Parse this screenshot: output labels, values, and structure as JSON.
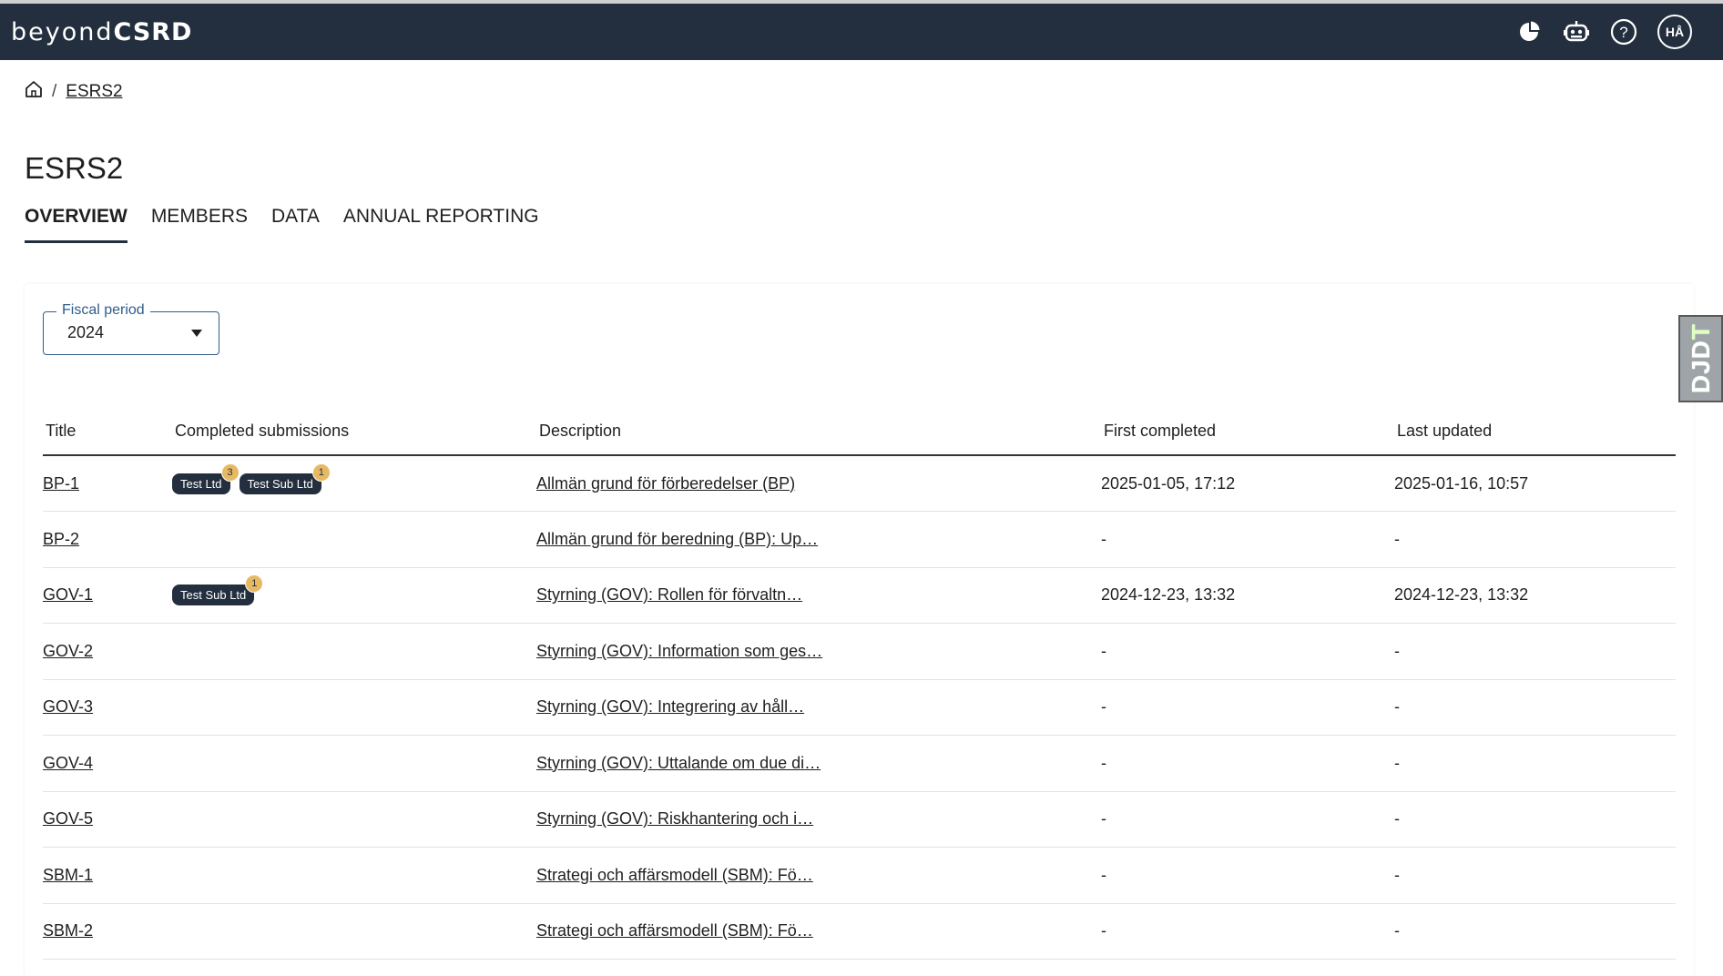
{
  "app": {
    "logo_thin": "beyond",
    "logo_bold": "CSRD",
    "avatar_initials": "HÅ"
  },
  "icons": {
    "chart": "pie-chart-icon",
    "bot": "robot-icon",
    "help": "help-circle-icon",
    "home": "home-icon"
  },
  "breadcrumb": {
    "separator": "/",
    "current": "ESRS2"
  },
  "page": {
    "title": "ESRS2"
  },
  "tabs": [
    {
      "label": "OVERVIEW",
      "active": true
    },
    {
      "label": "MEMBERS",
      "active": false
    },
    {
      "label": "DATA",
      "active": false
    },
    {
      "label": "ANNUAL REPORTING",
      "active": false
    }
  ],
  "fiscal_period": {
    "label": "Fiscal period",
    "value": "2024"
  },
  "table": {
    "headers": [
      "Title",
      "Completed submissions",
      "Description",
      "First completed",
      "Last updated"
    ],
    "rows": [
      {
        "title": "BP-1",
        "submissions": [
          {
            "name": "Test Ltd",
            "count": "3"
          },
          {
            "name": "Test Sub Ltd",
            "count": "1"
          }
        ],
        "description": "Allmän grund för förberedelser (BP)",
        "first_completed": "2025-01-05, 17:12",
        "last_updated": "2025-01-16, 10:57"
      },
      {
        "title": "BP-2",
        "submissions": [],
        "description": "Allmän grund för beredning (BP): Up…",
        "first_completed": "-",
        "last_updated": "-"
      },
      {
        "title": "GOV-1",
        "submissions": [
          {
            "name": "Test Sub Ltd",
            "count": "1"
          }
        ],
        "description": "Styrning (GOV): Rollen för förvaltn…",
        "first_completed": "2024-12-23, 13:32",
        "last_updated": "2024-12-23, 13:32"
      },
      {
        "title": "GOV-2",
        "submissions": [],
        "description": "Styrning (GOV): Information som ges…",
        "first_completed": "-",
        "last_updated": "-"
      },
      {
        "title": "GOV-3",
        "submissions": [],
        "description": "Styrning (GOV): Integrering av håll…",
        "first_completed": "-",
        "last_updated": "-"
      },
      {
        "title": "GOV-4",
        "submissions": [],
        "description": "Styrning (GOV): Uttalande om due di…",
        "first_completed": "-",
        "last_updated": "-"
      },
      {
        "title": "GOV-5",
        "submissions": [],
        "description": "Styrning (GOV): Riskhantering och i…",
        "first_completed": "-",
        "last_updated": "-"
      },
      {
        "title": "SBM-1",
        "submissions": [],
        "description": "Strategi och affärsmodell (SBM): Fö…",
        "first_completed": "-",
        "last_updated": "-"
      },
      {
        "title": "SBM-2",
        "submissions": [],
        "description": "Strategi och affärsmodell (SBM): Fö…",
        "first_completed": "-",
        "last_updated": "-"
      }
    ]
  },
  "debug_toolbar": {
    "label_main": "DJD",
    "label_accent": "T"
  }
}
